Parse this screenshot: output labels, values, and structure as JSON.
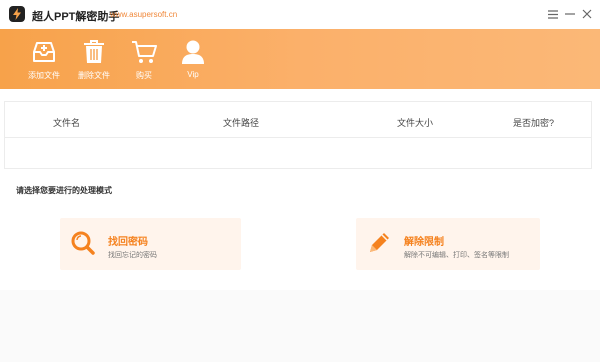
{
  "window": {
    "title": "超人PPT解密助手",
    "url": "www.asupersoft.cn",
    "logo_icon": "lightning-icon",
    "controls": [
      "menu-icon",
      "minimize-icon",
      "close-icon"
    ]
  },
  "toolbar": {
    "items": [
      {
        "label": "添加文件",
        "icon": "inbox-add-icon"
      },
      {
        "label": "删除文件",
        "icon": "trash-icon"
      },
      {
        "label": "购买",
        "icon": "cart-icon"
      },
      {
        "label": "Vip",
        "icon": "user-icon"
      }
    ]
  },
  "file_table": {
    "columns": [
      "文件名",
      "文件路径",
      "文件大小",
      "是否加密?"
    ],
    "rows": []
  },
  "mode": {
    "heading": "请选择您要进行的处理模式",
    "cards": [
      {
        "title": "找回密码",
        "desc": "找回忘记的密码",
        "icon": "search-icon"
      },
      {
        "title": "解除限制",
        "desc": "解除不可编辑、打印、签名等限制",
        "icon": "pencil-icon"
      }
    ]
  },
  "colors": {
    "accent": "#f5821f",
    "toolbar_start": "#f7a24a",
    "toolbar_end": "#fbb877",
    "card_bg": "#fff4ec"
  }
}
